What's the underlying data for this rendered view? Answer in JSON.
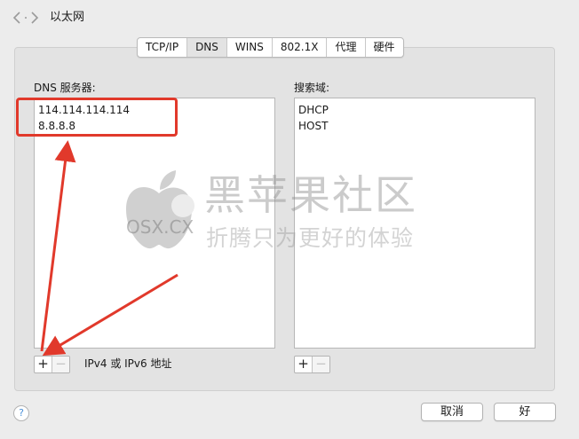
{
  "window": {
    "title": "以太网"
  },
  "tabs": [
    {
      "label": "TCP/IP",
      "active": false
    },
    {
      "label": "DNS",
      "active": true
    },
    {
      "label": "WINS",
      "active": false
    },
    {
      "label": "802.1X",
      "active": false
    },
    {
      "label": "代理",
      "active": false
    },
    {
      "label": "硬件",
      "active": false
    }
  ],
  "dns": {
    "label": "DNS 服务器:",
    "servers": [
      "114.114.114.114",
      "8.8.8.8"
    ],
    "add_label": "+",
    "remove_label": "−",
    "hint": "IPv4 或 IPv6 地址"
  },
  "search": {
    "label": "搜索域:",
    "domains": [
      "DHCP",
      "HOST"
    ],
    "add_label": "+",
    "remove_label": "−"
  },
  "footer": {
    "help_label": "?",
    "cancel_label": "取消",
    "ok_label": "好"
  },
  "watermark": {
    "title": "黑苹果社区",
    "subtitle": "折腾只为更好的体验",
    "domain": "OSX.CX"
  },
  "colors": {
    "annotation": "#e1392b",
    "help": "#4a90d9"
  },
  "icons": {
    "nav": "back-forward-chevrons",
    "logo": "apple-logo"
  }
}
